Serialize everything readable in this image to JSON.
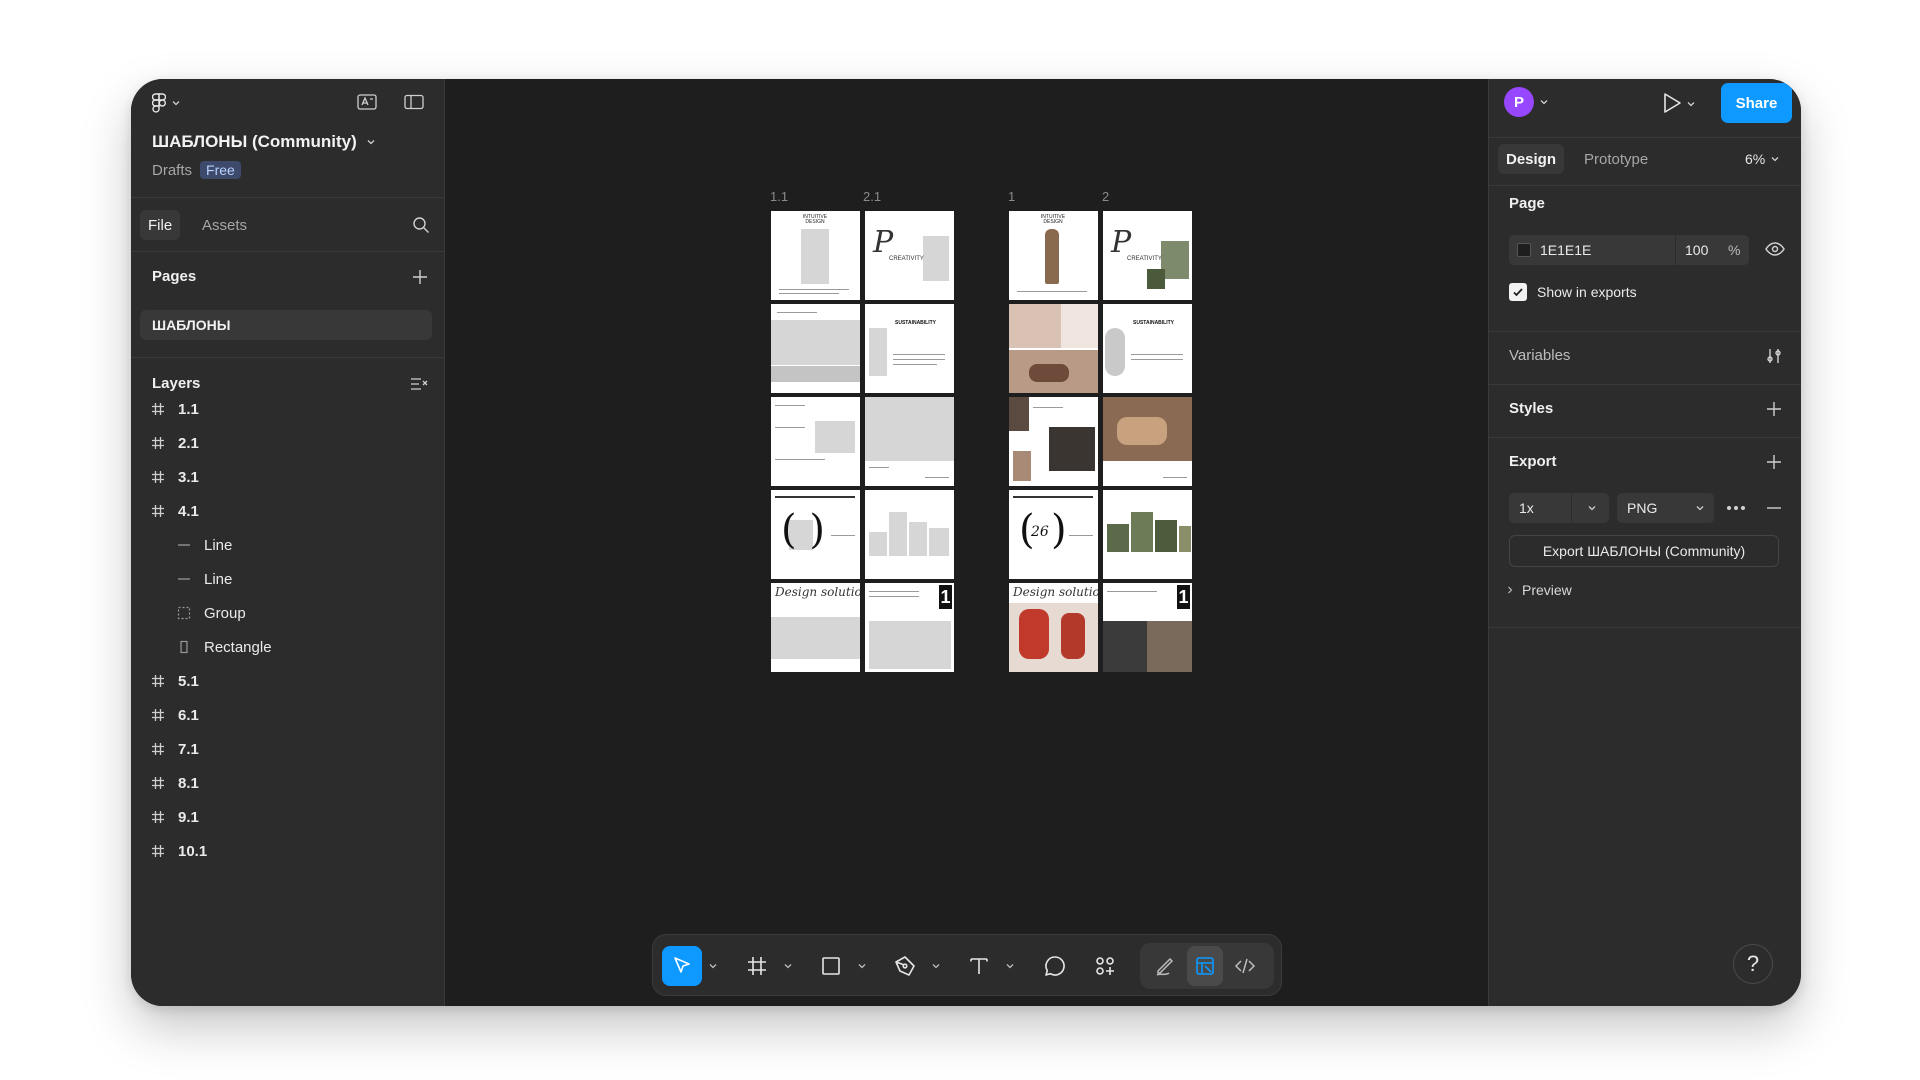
{
  "file": {
    "name": "ШАБЛОНЫ (Community)",
    "location": "Drafts",
    "plan_badge": "Free"
  },
  "left_tabs": [
    "File",
    "Assets"
  ],
  "pages": {
    "header": "Pages",
    "items": [
      "ШАБЛОНЫ"
    ]
  },
  "layers": {
    "header": "Layers",
    "items": [
      {
        "name": "1.1",
        "type": "frame",
        "depth": 0
      },
      {
        "name": "2.1",
        "type": "frame",
        "depth": 0
      },
      {
        "name": "3.1",
        "type": "frame",
        "depth": 0
      },
      {
        "name": "4.1",
        "type": "frame",
        "depth": 0
      },
      {
        "name": "Line",
        "type": "line",
        "depth": 1
      },
      {
        "name": "Line",
        "type": "line",
        "depth": 1
      },
      {
        "name": "Group",
        "type": "group",
        "depth": 1
      },
      {
        "name": "Rectangle",
        "type": "rectangle",
        "depth": 1
      },
      {
        "name": "5.1",
        "type": "frame",
        "depth": 0
      },
      {
        "name": "6.1",
        "type": "frame",
        "depth": 0
      },
      {
        "name": "7.1",
        "type": "frame",
        "depth": 0
      },
      {
        "name": "8.1",
        "type": "frame",
        "depth": 0
      },
      {
        "name": "9.1",
        "type": "frame",
        "depth": 0
      },
      {
        "name": "10.1",
        "type": "frame",
        "depth": 0
      }
    ]
  },
  "canvas": {
    "frame_labels": [
      "1.1",
      "2.1",
      "1",
      "2"
    ],
    "thumb_texts": {
      "intuitive": "INTUITIVE DESIGN",
      "creativity": "CREATIVITY",
      "sustainability": "SUSTAINABILITY",
      "number_26": "26",
      "design_solutions": "Design solutions",
      "one": "1"
    },
    "background": "#1E1E1E"
  },
  "header_right": {
    "avatar_letter": "P",
    "share_label": "Share"
  },
  "right_tabs": {
    "design": "Design",
    "prototype": "Prototype",
    "zoom": "6%"
  },
  "page_section": {
    "title": "Page",
    "color_hex": "1E1E1E",
    "opacity": "100",
    "opacity_unit": "%",
    "show_in_exports_label": "Show in exports",
    "show_in_exports_checked": true
  },
  "variables_title": "Variables",
  "styles_title": "Styles",
  "export_section": {
    "title": "Export",
    "scale": "1x",
    "format": "PNG",
    "export_button": "Export ШАБЛОНЫ (Community)",
    "preview_label": "Preview"
  },
  "help_label": "?",
  "colors": {
    "accent": "#0D99FF",
    "avatar": "#9747FF",
    "badge_bg": "#3D4A6B",
    "badge_text": "#B8D1FF"
  },
  "toolbar_tools": [
    "move-tool",
    "frame-tool",
    "shape-tool",
    "pen-tool",
    "text-tool",
    "comment-tool",
    "actions-tool",
    "draw-mode",
    "design-mode",
    "dev-mode"
  ]
}
